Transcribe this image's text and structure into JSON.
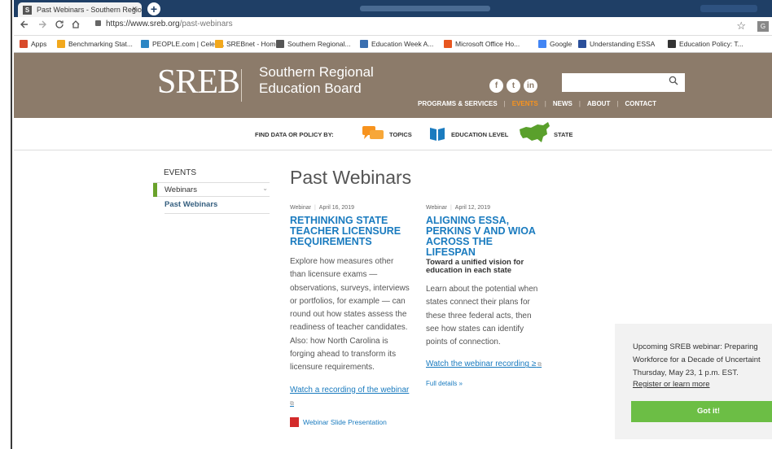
{
  "browser": {
    "tab_title": "Past Webinars - Southern Region",
    "tab_favicon": "S",
    "tab_close": "×",
    "new_tab": "+",
    "url_host": "https://www.sreb.org",
    "url_path": "/past-webinars",
    "nav_icons": [
      "back-icon",
      "forward-icon",
      "reload-icon",
      "home-icon"
    ],
    "bookmarks": [
      {
        "label": "Apps",
        "color": "#d84a2b"
      },
      {
        "label": "Benchmarking Stat...",
        "color": "#f2a81d"
      },
      {
        "label": "PEOPLE.com | Celeb...",
        "color": "#2d86c4"
      },
      {
        "label": "SREBnet - Home",
        "color": "#f2a81d"
      },
      {
        "label": "Southern Regional...",
        "color": "#555555"
      },
      {
        "label": "Education Week A...",
        "color": "#3a6fb0"
      },
      {
        "label": "Microsoft Office Ho...",
        "color": "#e8561f"
      },
      {
        "label": "Google",
        "color": "#4285f4"
      },
      {
        "label": "Understanding ESSA",
        "color": "#2a4f9a"
      },
      {
        "label": "Education Policy: T...",
        "color": "#333333"
      }
    ]
  },
  "site": {
    "logo": "SREB",
    "org_line1": "Southern Regional",
    "org_line2": "Education Board",
    "socials": [
      "f",
      "t",
      "in"
    ],
    "nav": [
      "PROGRAMS & SERVICES",
      "EVENTS",
      "NEWS",
      "ABOUT",
      "CONTACT"
    ],
    "nav_sep": "|",
    "active_nav": "EVENTS",
    "brand_color": "#8c7b6a",
    "accent_color": "#f7931e"
  },
  "finder": {
    "label": "FIND DATA OR POLICY BY:",
    "items": [
      "TOPICS",
      "EDUCATION LEVEL",
      "STATE"
    ]
  },
  "sidebar": {
    "heading": "EVENTS",
    "item": "Webinars",
    "chevron": "⌄",
    "sub": "Past Webinars"
  },
  "main": {
    "title": "Past Webinars",
    "articles": [
      {
        "type": "Webinar",
        "date": "April 16, 2019",
        "title": "RETHINKING STATE TEACHER LICENSURE REQUIREMENTS",
        "subtitle": "",
        "body": "Explore how measures other than licensure exams — observations, surveys, interviews or portfolios, for example — can round out how states assess the readiness of teacher candidates. Also: how North Carolina is forging ahead to transform its licensure requirements.",
        "link": "Watch a recording of the webinar",
        "pdf": "Webinar Slide Presentation"
      },
      {
        "type": "Webinar",
        "date": "April 12, 2019",
        "title": "ALIGNING ESSA, PERKINS V AND WIOA ACROSS THE LIFESPAN",
        "subtitle": "Toward a unified vision for education in each state",
        "body": "Learn about the potential when states connect their plans for these three federal acts, then see how states can identify points of connection.",
        "link": "Watch the webinar recording ≥",
        "details": "Full details »"
      }
    ]
  },
  "popup": {
    "line1": "Upcoming SREB webinar: Preparing",
    "line2": "Workforce for a Decade of Uncertaint",
    "line3": "Thursday, May 23, 1 p.m. EST.",
    "link": "Register or learn more",
    "button": "Got it!"
  }
}
